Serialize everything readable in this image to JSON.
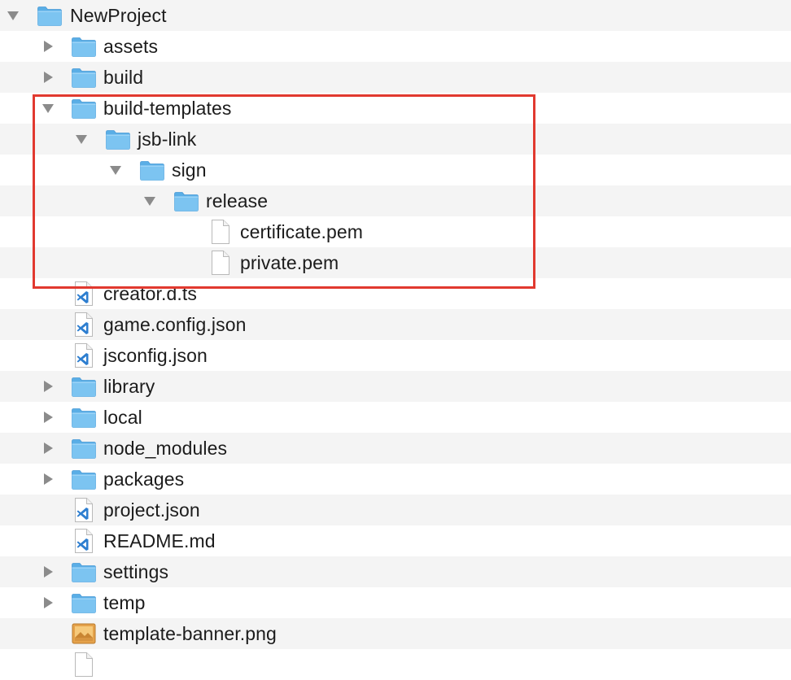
{
  "colors": {
    "highlight_border": "#e1392f",
    "folder_blue": "#7cc4f1",
    "folder_blue_dark": "#5aaee6",
    "row_alt_background": "#f4f4f4",
    "vscode_blue": "#2d7ed0"
  },
  "tree": {
    "rows": [
      {
        "label": "NewProject",
        "depth": 0,
        "kind": "folder",
        "expanded": true,
        "icon": "folder-icon"
      },
      {
        "label": "assets",
        "depth": 1,
        "kind": "folder",
        "expanded": false,
        "icon": "folder-icon"
      },
      {
        "label": "build",
        "depth": 1,
        "kind": "folder",
        "expanded": false,
        "icon": "folder-icon"
      },
      {
        "label": "build-templates",
        "depth": 1,
        "kind": "folder",
        "expanded": true,
        "icon": "folder-icon"
      },
      {
        "label": "jsb-link",
        "depth": 2,
        "kind": "folder",
        "expanded": true,
        "icon": "folder-icon"
      },
      {
        "label": "sign",
        "depth": 3,
        "kind": "folder",
        "expanded": true,
        "icon": "folder-icon"
      },
      {
        "label": "release",
        "depth": 4,
        "kind": "folder",
        "expanded": true,
        "icon": "folder-icon"
      },
      {
        "label": "certificate.pem",
        "depth": 5,
        "kind": "file",
        "icon": "blank-document-icon"
      },
      {
        "label": "private.pem",
        "depth": 5,
        "kind": "file",
        "icon": "blank-document-icon"
      },
      {
        "label": "creator.d.ts",
        "depth": 1,
        "kind": "file",
        "icon": "vscode-document-icon"
      },
      {
        "label": "game.config.json",
        "depth": 1,
        "kind": "file",
        "icon": "vscode-document-icon"
      },
      {
        "label": "jsconfig.json",
        "depth": 1,
        "kind": "file",
        "icon": "vscode-document-icon"
      },
      {
        "label": "library",
        "depth": 1,
        "kind": "folder",
        "expanded": false,
        "icon": "folder-icon"
      },
      {
        "label": "local",
        "depth": 1,
        "kind": "folder",
        "expanded": false,
        "icon": "folder-icon"
      },
      {
        "label": "node_modules",
        "depth": 1,
        "kind": "folder",
        "expanded": false,
        "icon": "folder-icon"
      },
      {
        "label": "packages",
        "depth": 1,
        "kind": "folder",
        "expanded": false,
        "icon": "folder-icon"
      },
      {
        "label": "project.json",
        "depth": 1,
        "kind": "file",
        "icon": "vscode-document-icon"
      },
      {
        "label": "README.md",
        "depth": 1,
        "kind": "file",
        "icon": "vscode-document-icon"
      },
      {
        "label": "settings",
        "depth": 1,
        "kind": "folder",
        "expanded": false,
        "icon": "folder-icon"
      },
      {
        "label": "temp",
        "depth": 1,
        "kind": "folder",
        "expanded": false,
        "icon": "folder-icon"
      },
      {
        "label": "template-banner.png",
        "depth": 1,
        "kind": "file",
        "icon": "image-document-icon"
      },
      {
        "label": "",
        "depth": 1,
        "kind": "file",
        "icon": "blank-document-icon"
      }
    ]
  }
}
